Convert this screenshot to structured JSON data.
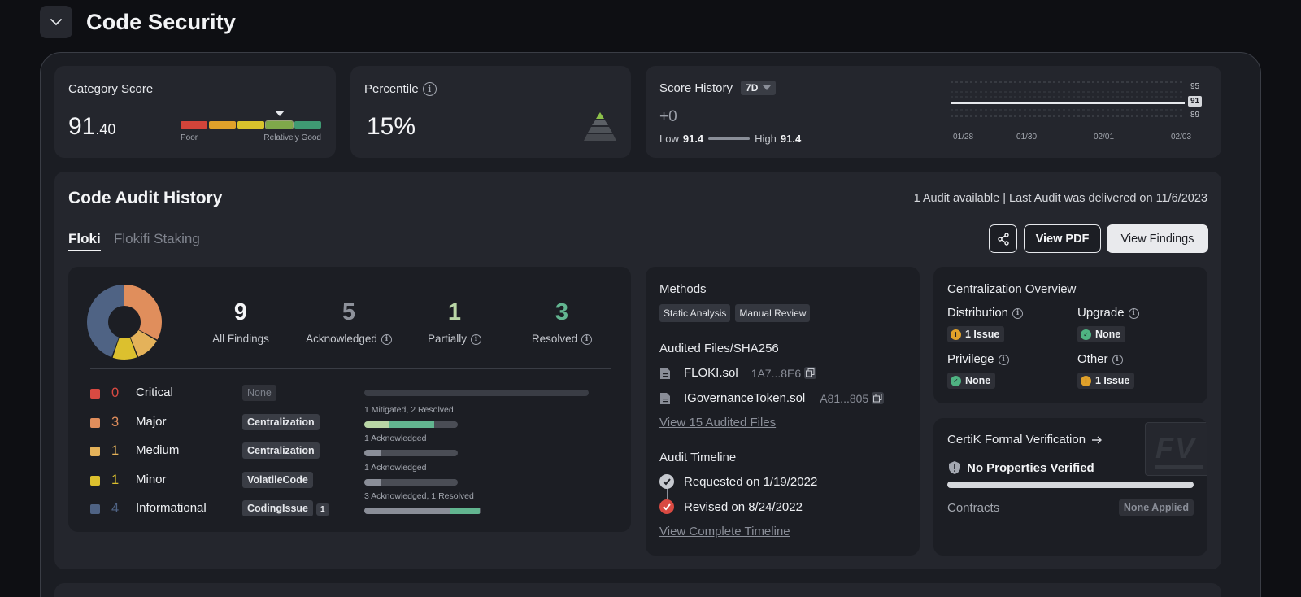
{
  "header": {
    "title": "Code Security"
  },
  "category_score": {
    "label": "Category Score",
    "value_int": "91",
    "value_dec": ".40",
    "scale_left": "Poor",
    "scale_right": "Relatively Good",
    "scale_colors": [
      "#d2443a",
      "#e0a12a",
      "#d8c32c",
      "#7fa84a",
      "#3f9a73"
    ],
    "active_segment": 3
  },
  "percentile": {
    "label": "Percentile",
    "value": "15%"
  },
  "score_history": {
    "label": "Score History",
    "range": "7D",
    "change": "+0",
    "low_label": "Low",
    "low_value": "91.4",
    "high_label": "High",
    "high_value": "91.4",
    "chart": {
      "y_top": "95",
      "y_current": "91",
      "y_bottom": "89",
      "x_labels": [
        "01/28",
        "01/30",
        "02/01",
        "02/03"
      ]
    }
  },
  "audit": {
    "title": "Code Audit History",
    "summary": "1 Audit available | Last Audit was delivered on 11/6/2023",
    "tabs": [
      "Floki",
      "Flokifi Staking"
    ],
    "active_tab": 0,
    "buttons": {
      "pdf": "View PDF",
      "findings": "View Findings"
    },
    "findings": {
      "stats": [
        {
          "value": "9",
          "label": "All Findings",
          "color": "#f4f5f7"
        },
        {
          "value": "5",
          "label": "Acknowledged",
          "color": "#8d919a"
        },
        {
          "value": "1",
          "label": "Partially",
          "color": "#b9d6a6"
        },
        {
          "value": "3",
          "label": "Resolved",
          "color": "#62b590"
        }
      ],
      "severities": [
        {
          "count": "0",
          "name": "Critical",
          "color": "#d94a42",
          "tag": "None",
          "tag_badge": "",
          "caption": ""
        },
        {
          "count": "3",
          "name": "Major",
          "color": "#e08e5c",
          "tag": "Centralization",
          "tag_badge": "",
          "caption": "1 Mitigated, 2 Resolved"
        },
        {
          "count": "1",
          "name": "Medium",
          "color": "#e4b25a",
          "tag": "Centralization",
          "tag_badge": "",
          "caption": "1 Acknowledged"
        },
        {
          "count": "1",
          "name": "Minor",
          "color": "#dcc02e",
          "tag": "VolatileCode",
          "tag_badge": "",
          "caption": "1 Acknowledged"
        },
        {
          "count": "4",
          "name": "Informational",
          "color": "#4f6384",
          "tag": "CodingIssue",
          "tag_badge": "1",
          "caption": "3 Acknowledged, 1 Resolved"
        }
      ]
    },
    "methods": {
      "title": "Methods",
      "items": [
        "Static Analysis",
        "Manual Review"
      ],
      "files_title": "Audited Files/SHA256",
      "files": [
        {
          "name": "FLOKI.sol",
          "hash": "1A7...8E6"
        },
        {
          "name": "IGovernanceToken.sol",
          "hash": "A81...805"
        }
      ],
      "view_files": "View 15 Audited Files",
      "timeline_title": "Audit Timeline",
      "timeline": [
        {
          "text": "Requested on 1/19/2022"
        },
        {
          "text": "Revised on 8/24/2022"
        }
      ],
      "view_timeline": "View Complete Timeline"
    },
    "centralization": {
      "title": "Centralization Overview",
      "items": [
        {
          "label": "Distribution",
          "status": "1 Issue"
        },
        {
          "label": "Upgrade",
          "status": "None"
        },
        {
          "label": "Privilege",
          "status": "None"
        },
        {
          "label": "Other",
          "status": "1 Issue"
        }
      ]
    },
    "formal_verification": {
      "title": "CertiK Formal Verification",
      "status": "No Properties Verified",
      "contracts_label": "Contracts",
      "contracts_value": "None Applied",
      "logo_text": "FV"
    }
  }
}
